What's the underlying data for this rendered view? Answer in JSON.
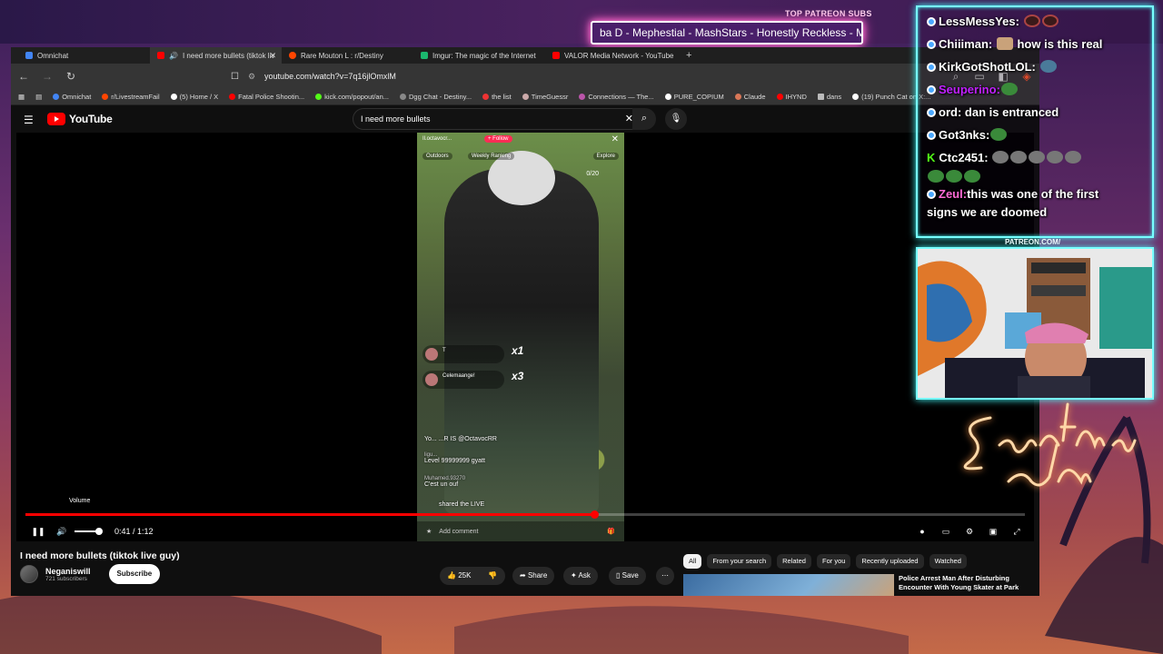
{
  "overlay": {
    "patreon_header": "TOP PATREON SUBS",
    "marquee": "ba D - Mephestial - MashStars - Honestly Reckless - Moo",
    "patreon_url": "PATREON.COM/",
    "chat": [
      {
        "name": "LessMessYes:",
        "name_color": "#ffffff",
        "msg": ""
      },
      {
        "name": "Chiiiman:",
        "name_color": "#ffffff",
        "msg": "how is this real"
      },
      {
        "name": "KirkGotShotLOL:",
        "name_color": "#ffffff",
        "msg": ""
      },
      {
        "name": "Seuperino:",
        "name_color": "#c020ff",
        "msg": ""
      },
      {
        "name": "ord:",
        "name_color": "#ffffff",
        "msg": "dan is entranced"
      },
      {
        "name": "Got3nks:",
        "name_color": "#ffffff",
        "msg": ""
      },
      {
        "name": "Ctc2451:",
        "name_color": "#ffffff",
        "msg": ""
      },
      {
        "name": "Zeul:",
        "name_color": "#ff6bd6",
        "msg": "this was one of the first"
      },
      {
        "name": "",
        "name_color": "#ffffff",
        "msg": "signs we are doomed"
      }
    ]
  },
  "browser": {
    "tabs": [
      {
        "label": "Omnichat",
        "color": "#4285f4",
        "active": false
      },
      {
        "label": "I need more bullets (tiktok liv",
        "color": "#ff0000",
        "active": true
      },
      {
        "label": "Rare Mouton L : r/Destiny",
        "color": "#ff4500",
        "active": false
      },
      {
        "label": "Imgur: The magic of the Internet",
        "color": "#1bb76e",
        "active": false
      },
      {
        "label": "VALOR Media Network - YouTube",
        "color": "#ff0000",
        "active": false
      }
    ],
    "url": "youtube.com/watch?v=7q16jlOmxlM",
    "bookmarks": [
      "Omnichat",
      "r/LivestreamFail",
      "(5) Home / X",
      "Fatal Police Shootin...",
      "kick.com/popout/an...",
      "Dgg Chat - Destiny...",
      "the list",
      "TimeGuessr",
      "Connections — The...",
      "PURE_COPIUM",
      "Claude",
      "IHYND",
      "dans",
      "(19) Punch Cat on X:..."
    ]
  },
  "youtube": {
    "search_value": "I need more bullets",
    "player": {
      "time": "0:41 / 1:12",
      "progress": 0.569,
      "volume_tooltip": "Volume",
      "tiktok": {
        "handle": "Il.octavocr...",
        "follow": "+ Follow",
        "chip_left": "Outdoors",
        "chip_right": "Weekly Ranking",
        "chip_explore": "Explore",
        "viewer_count": "0/20",
        "gift1_name": "T",
        "gift1_mult": "x1",
        "gift2_name": "Celemaange!",
        "gift2_mult": "x3",
        "comment1": "Yo... ...R IS @OctavocRR",
        "comment2_user": "ligu...",
        "comment2": "Level 99999999 gyatt",
        "comment3_user": "Muhamed.93270",
        "comment3": "C'est un ouf",
        "comment4": "shared the LIVE",
        "add_comment": "Add comment"
      }
    },
    "video_title": "I need more bullets (tiktok live guy)",
    "channel": {
      "name": "Neganiswill",
      "subs": "721 subscribers",
      "subscribe_label": "Subscribe"
    },
    "actions": {
      "likes": "25K",
      "share": "Share",
      "ask": "Ask",
      "save": "Save"
    },
    "chips": [
      "All",
      "From your search",
      "Related",
      "For you",
      "Recently uploaded",
      "Watched"
    ],
    "rec_title": "Police Arrest Man After Disturbing Encounter With Young Skater at Park"
  }
}
